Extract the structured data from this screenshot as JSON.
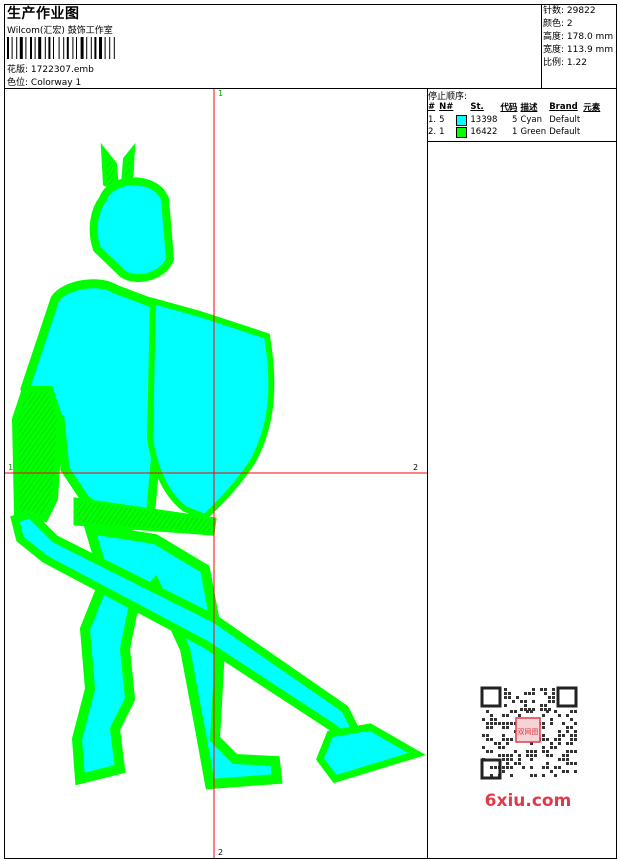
{
  "header": {
    "title": "生产作业图",
    "subtitle": "Wilcom(汇宏) 鼓饰工作室",
    "design_file_label": "花版:",
    "design_file": "1722307.emb",
    "colorway_label": "色位:",
    "colorway": "Colorway 1"
  },
  "stats": {
    "stitches_label": "针数:",
    "stitches": "29822",
    "colors_label": "颜色:",
    "colors": "2",
    "height_label": "高度:",
    "height": "178.0 mm",
    "width_label": "宽度:",
    "width": "113.9 mm",
    "scale_label": "比例:",
    "scale": "1.22"
  },
  "stop_sequence": {
    "title": "停止顺序:",
    "columns": [
      "#",
      "N#",
      "St.",
      "代码",
      "描述",
      "Brand",
      "元素"
    ],
    "rows": [
      {
        "num": "1.",
        "n": "5",
        "color": "#00ffff",
        "st": "13398",
        "code": "5",
        "desc": "Cyan",
        "brand": "Default",
        "element": ""
      },
      {
        "num": "2.",
        "n": "1",
        "color": "#00ff00",
        "st": "16422",
        "code": "1",
        "desc": "Green",
        "brand": "Default",
        "element": ""
      }
    ]
  },
  "crosshair": {
    "top": "1",
    "left": "1",
    "right": "2",
    "bottom": "2"
  },
  "watermark": {
    "text": "6xiu.com",
    "seal": "双网图"
  },
  "colors": {
    "cyan": "#00ffff",
    "green": "#00ff00",
    "crosshair": "#ff0000",
    "watermark": "#e03a4a"
  }
}
